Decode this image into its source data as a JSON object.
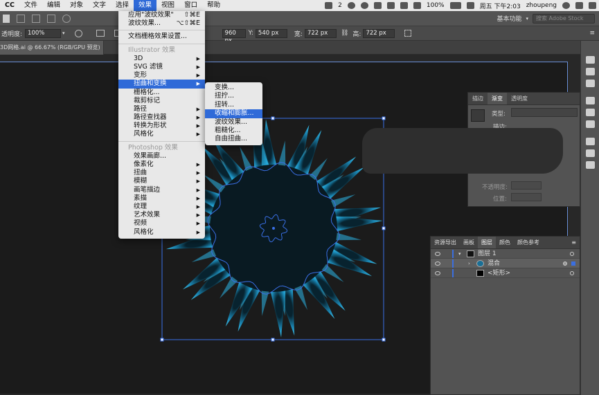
{
  "menubar": {
    "app": "CC",
    "items": [
      "文件",
      "编辑",
      "对象",
      "文字",
      "选择",
      "效果",
      "视图",
      "窗口",
      "帮助"
    ],
    "active_index": 5,
    "badge": "2",
    "battery": "100%",
    "datetime": "周五 下午2:03",
    "user": "zhoupeng"
  },
  "appbar": {
    "workspace": "基本功能",
    "search_placeholder": "搜索 Adobe Stock"
  },
  "ctrlbar": {
    "opacity_label": "透明度:",
    "opacity_value": "100%",
    "x_value": "960 px",
    "y_label": "Y:",
    "y_value": "540 px",
    "w_label": "宽:",
    "w_value": "722 px",
    "h_label": "高:",
    "h_value": "722 px"
  },
  "document_tab": "3D网格.ai @ 66.67% (RGB/GPU 预览)",
  "effect_menu": {
    "apply_last": "应用\"波纹效果\"",
    "apply_last_shortcut": "⇧⌘E",
    "last_effect": "波纹效果...",
    "last_effect_shortcut": "⌥⇧⌘E",
    "doc_raster": "文档栅格效果设置...",
    "ai_section": "Illustrator 效果",
    "ai_items": [
      "3D",
      "SVG 滤镜",
      "变形",
      "扭曲和变换",
      "栅格化...",
      "裁剪标记",
      "路径",
      "路径查找器",
      "转换为形状",
      "风格化"
    ],
    "ps_section": "Photoshop 效果",
    "ps_items": [
      "效果画廊...",
      "像素化",
      "扭曲",
      "模糊",
      "画笔描边",
      "素描",
      "纹理",
      "艺术效果",
      "视频",
      "风格化"
    ]
  },
  "distort_submenu": [
    "变换...",
    "扭拧...",
    "扭转...",
    "收缩和膨胀...",
    "波纹效果...",
    "粗糙化...",
    "自由扭曲..."
  ],
  "gradient_panel": {
    "tabs": [
      "描边",
      "渐变",
      "透明度"
    ],
    "type_label": "类型:",
    "stroke_label": "描边:",
    "opacity_label": "不透明度:",
    "position_label": "位置:"
  },
  "layers_panel": {
    "tabs": [
      "资源导出",
      "画板",
      "图层",
      "颜色",
      "颜色参考"
    ],
    "rows": [
      {
        "name": "图层 1"
      },
      {
        "name": "混合"
      },
      {
        "name": "<矩形>"
      }
    ]
  },
  "colors": {
    "accent": "#2f6ad8",
    "flower": "#2bb7e8"
  }
}
